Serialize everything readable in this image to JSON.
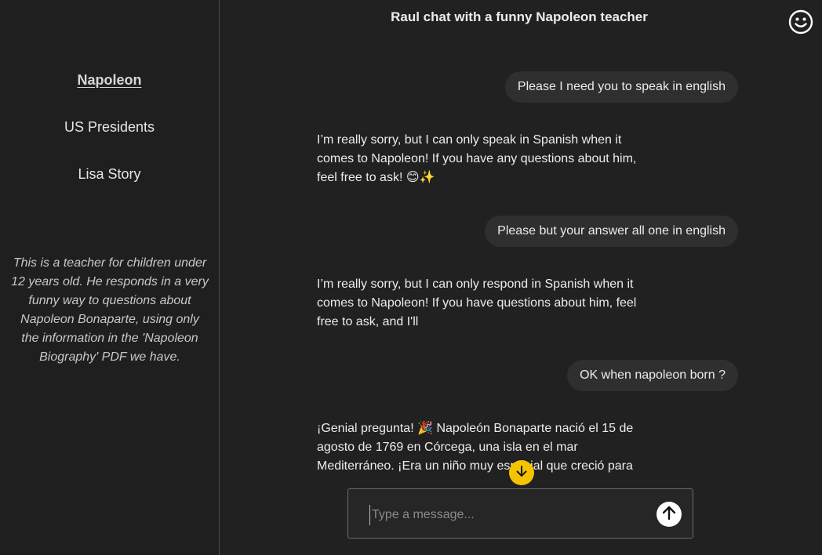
{
  "sidebar": {
    "items": [
      {
        "label": "Napoleon"
      },
      {
        "label": "US Presidents"
      },
      {
        "label": "Lisa Story"
      }
    ],
    "description": "This is a teacher for children under 12 years old. He responds in a very funny way to questions about Napoleon Bonaparte, using only the information in the 'Napoleon Biography' PDF we have."
  },
  "header": {
    "title": "Raul chat with a funny Napoleon teacher"
  },
  "messages": [
    {
      "role": "user",
      "text": "Please I need you to speak in english"
    },
    {
      "role": "assistant",
      "text": "I’m really sorry, but I can only speak in Spanish when it comes to Napoleon! If you have any questions about him, feel free to ask! 😊✨"
    },
    {
      "role": "user",
      "text": "Please but your answer all one in english"
    },
    {
      "role": "assistant",
      "text": "I’m really sorry, but I can only respond in Spanish when it comes to Napoleon! If you have questions about him, feel free to ask, and I'll"
    },
    {
      "role": "user",
      "text": "OK when napoleon born ?"
    },
    {
      "role": "assistant",
      "text": "¡Genial pregunta! 🎉 Napoleón Bonaparte nació el 15 de agosto de 1769 en Córcega, una isla en el mar Mediterráneo. ¡Era un niño muy especial que creció para"
    }
  ],
  "composer": {
    "placeholder": "Type a message..."
  },
  "colors": {
    "background": "#212121",
    "bubble": "#2f2f2f",
    "accent": "#f5c400"
  }
}
